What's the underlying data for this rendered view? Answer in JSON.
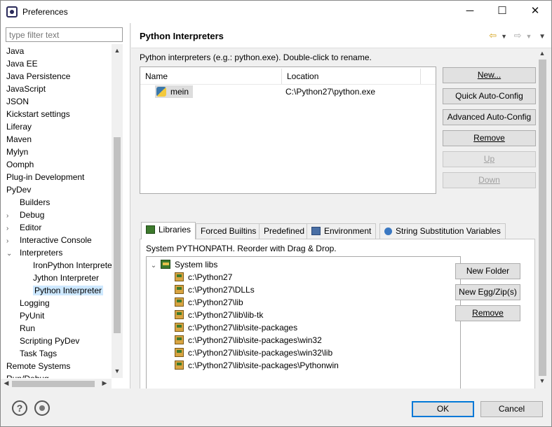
{
  "window": {
    "title": "Preferences",
    "minimize": "─",
    "maximize": "☐",
    "close": "✕"
  },
  "sidebar": {
    "filter_placeholder": "type filter text",
    "items": [
      {
        "label": "Java",
        "indent": 0
      },
      {
        "label": "Java EE",
        "indent": 0
      },
      {
        "label": "Java Persistence",
        "indent": 0
      },
      {
        "label": "JavaScript",
        "indent": 0
      },
      {
        "label": "JSON",
        "indent": 0
      },
      {
        "label": "Kickstart settings",
        "indent": 0
      },
      {
        "label": "Liferay",
        "indent": 0
      },
      {
        "label": "Maven",
        "indent": 0
      },
      {
        "label": "Mylyn",
        "indent": 0
      },
      {
        "label": "Oomph",
        "indent": 0
      },
      {
        "label": "Plug-in Development",
        "indent": 0
      },
      {
        "label": "PyDev",
        "indent": 0
      },
      {
        "label": "Builders",
        "indent": 1
      },
      {
        "label": "Debug",
        "indent": 1,
        "twisty": "›"
      },
      {
        "label": "Editor",
        "indent": 1,
        "twisty": "›"
      },
      {
        "label": "Interactive Console",
        "indent": 1,
        "twisty": "›"
      },
      {
        "label": "Interpreters",
        "indent": 1,
        "twisty": "⌄"
      },
      {
        "label": "IronPython Interprete",
        "indent": 2
      },
      {
        "label": "Jython Interpreter",
        "indent": 2
      },
      {
        "label": "Python Interpreter",
        "indent": 2,
        "selected": true
      },
      {
        "label": "Logging",
        "indent": 1
      },
      {
        "label": "PyUnit",
        "indent": 1
      },
      {
        "label": "Run",
        "indent": 1
      },
      {
        "label": "Scripting PyDev",
        "indent": 1
      },
      {
        "label": "Task Tags",
        "indent": 1
      },
      {
        "label": "Remote Systems",
        "indent": 0
      },
      {
        "label": "Run/Debug",
        "indent": 0
      }
    ]
  },
  "page": {
    "title": "Python Interpreters",
    "description": "Python interpreters (e.g.: python.exe).   Double-click to rename.",
    "table": {
      "columns": [
        "Name",
        "Location"
      ],
      "rows": [
        {
          "name": "mein",
          "location": "C:\\Python27\\python.exe"
        }
      ]
    },
    "buttons": {
      "new": "New...",
      "quick_auto_config": "Quick Auto-Config",
      "advanced_auto_config": "Advanced Auto-Config",
      "remove": "Remove",
      "up": "Up",
      "down": "Down"
    },
    "tabs": [
      "Libraries",
      "Forced Builtins",
      "Predefined",
      "Environment",
      "String Substitution Variables"
    ],
    "libraries": {
      "description": "System PYTHONPATH.   Reorder with Drag & Drop.",
      "root": "System libs",
      "paths": [
        "c:\\Python27",
        "c:\\Python27\\DLLs",
        "c:\\Python27\\lib",
        "c:\\Python27\\lib\\lib-tk",
        "c:\\Python27\\lib\\site-packages",
        "c:\\Python27\\lib\\site-packages\\win32",
        "c:\\Python27\\lib\\site-packages\\win32\\lib",
        "c:\\Python27\\lib\\site-packages\\Pythonwin"
      ],
      "buttons": {
        "new_folder": "New Folder",
        "new_egg": "New Egg/Zip(s)",
        "remove": "Remove"
      }
    }
  },
  "footer": {
    "ok": "OK",
    "cancel": "Cancel"
  }
}
